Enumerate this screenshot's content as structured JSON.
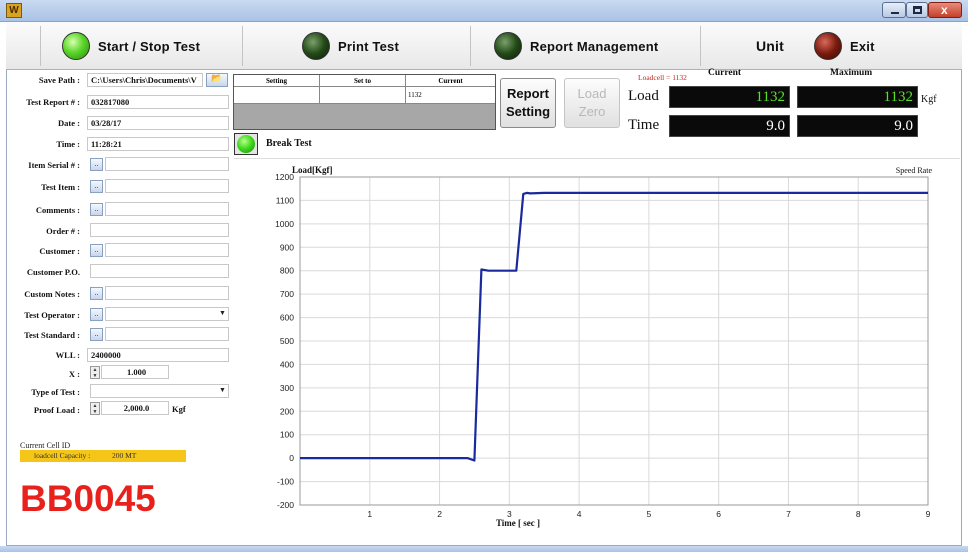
{
  "window": {
    "app_icon": "app-icon",
    "close_glyph": "x"
  },
  "toolbar": {
    "start_stop": {
      "label": "Start / Stop Test",
      "light": "green",
      "icon": "status-light-icon"
    },
    "print": {
      "label": "Print Test",
      "light": "dark-green",
      "icon": "status-light-icon"
    },
    "report_mgmt": {
      "label": "Report Management",
      "light": "dark-green",
      "icon": "status-light-icon"
    },
    "unit": {
      "label": "Unit"
    },
    "exit": {
      "label": "Exit",
      "light": "dark-red",
      "icon": "status-light-icon"
    }
  },
  "form": {
    "save_path": {
      "label": "Save Path :",
      "value": "C:\\Users\\Chris\\Documents\\V",
      "folder_icon": "folder-icon"
    },
    "test_report": {
      "label": "Test Report # :",
      "value": "032817080"
    },
    "date": {
      "label": "Date :",
      "value": "03/28/17"
    },
    "time": {
      "label": "Time :",
      "value": "11:28:21"
    },
    "item_serial": {
      "label": "Item Serial # :",
      "value": ""
    },
    "test_item": {
      "label": "Test Item :",
      "value": ""
    },
    "comments": {
      "label": "Comments :",
      "value": ""
    },
    "order": {
      "label": "Order # :",
      "value": ""
    },
    "customer": {
      "label": "Customer :",
      "value": ""
    },
    "customer_po": {
      "label": "Customer P.O.",
      "value": ""
    },
    "custom_notes": {
      "label": "Custom Notes :",
      "value": ""
    },
    "test_operator": {
      "label": "Test Operator :",
      "value": ""
    },
    "test_standard": {
      "label": "Test Standard :",
      "value": ""
    },
    "wll": {
      "label": "WLL :",
      "value": "2400000"
    },
    "x": {
      "label": "X :",
      "value": "1.000"
    },
    "type_of_test": {
      "label": "Type of Test :",
      "value": ""
    },
    "proof_load": {
      "label": "Proof Load :",
      "value": "2,000.0",
      "unit": "Kgf"
    },
    "picker_glyph": "..",
    "combo_glyph": "▼",
    "spin_up": "▲",
    "spin_down": "▼"
  },
  "cell": {
    "caption": "Current Cell ID",
    "capacity_label": "loadcell Capacity :",
    "capacity_value": "200 MT",
    "id": "BB0045"
  },
  "setting_table": {
    "headers": [
      "Setting",
      "Set to",
      "Current"
    ],
    "row": [
      "",
      "",
      "1132"
    ]
  },
  "buttons": {
    "report_setting": [
      "Report",
      "Setting"
    ],
    "load_zero": [
      "Load",
      "Zero"
    ]
  },
  "readout": {
    "loadcell_text": "Loadcell =   1132",
    "current_header": "Current",
    "maximum_header": "Maximum",
    "load_label": "Load",
    "time_label": "Time",
    "load_current": "1132",
    "load_max": "1132",
    "time_current": "9.0",
    "time_max": "9.0",
    "unit": "Kgf"
  },
  "break_test": {
    "label": "Break Test",
    "icon": "status-light-icon"
  },
  "colors": {
    "line": "#1a2a9c",
    "grid": "#d9d9d9",
    "lcd_green": "#5be02a",
    "cell_id_red": "#e8211c",
    "capacity_bg": "#f5c518"
  },
  "chart_data": {
    "type": "line",
    "title": "",
    "ylabel": "Load[Kgf]",
    "xlabel": "Time [ sec ]",
    "top_right_label": "Speed Rate",
    "xlim": [
      0,
      9
    ],
    "ylim": [
      -200,
      1200
    ],
    "x_ticks": [
      1,
      2,
      3,
      4,
      5,
      6,
      7,
      8,
      9
    ],
    "y_ticks": [
      -200,
      -100,
      0,
      100,
      200,
      300,
      400,
      500,
      600,
      700,
      800,
      900,
      1000,
      1100,
      1200
    ],
    "grid": true,
    "series": [
      {
        "x": [
          0,
          2.4,
          2.5,
          2.55,
          2.6,
          2.7,
          3.1,
          3.2,
          3.25,
          3.3,
          3.5,
          9
        ],
        "y": [
          0,
          0,
          -10,
          400,
          805,
          800,
          800,
          1128,
          1132,
          1130,
          1132,
          1132
        ]
      }
    ]
  }
}
